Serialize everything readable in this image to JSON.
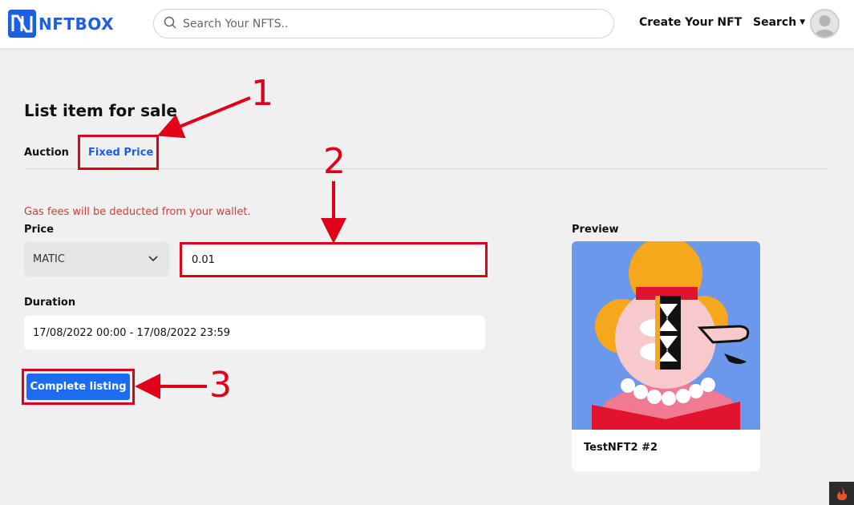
{
  "header": {
    "logo_nft": "NFT",
    "logo_box": "BOX",
    "search_placeholder": "Search Your NFTS..",
    "nav_create": "Create Your NFT",
    "nav_search": "Search"
  },
  "page": {
    "title": "List item for sale",
    "tabs": [
      {
        "label": "Auction"
      },
      {
        "label": "Fixed Price"
      }
    ],
    "gas_note": "Gas fees will be deducted from your wallet.",
    "price_label": "Price",
    "currency": "MATIC",
    "price_value": "0.01",
    "duration_label": "Duration",
    "duration_value": "17/08/2022 00:00 - 17/08/2022 23:59",
    "complete_button": "Complete listing"
  },
  "preview": {
    "label": "Preview",
    "nft_name": "TestNFT2 #2"
  },
  "annotations": {
    "step_1": "1",
    "step_2": "2",
    "step_3": "3"
  },
  "colors": {
    "accent": "#1d5fe0",
    "button": "#1d6cf0",
    "annotation": "#e0001a",
    "warning_text": "#d23a3a"
  }
}
